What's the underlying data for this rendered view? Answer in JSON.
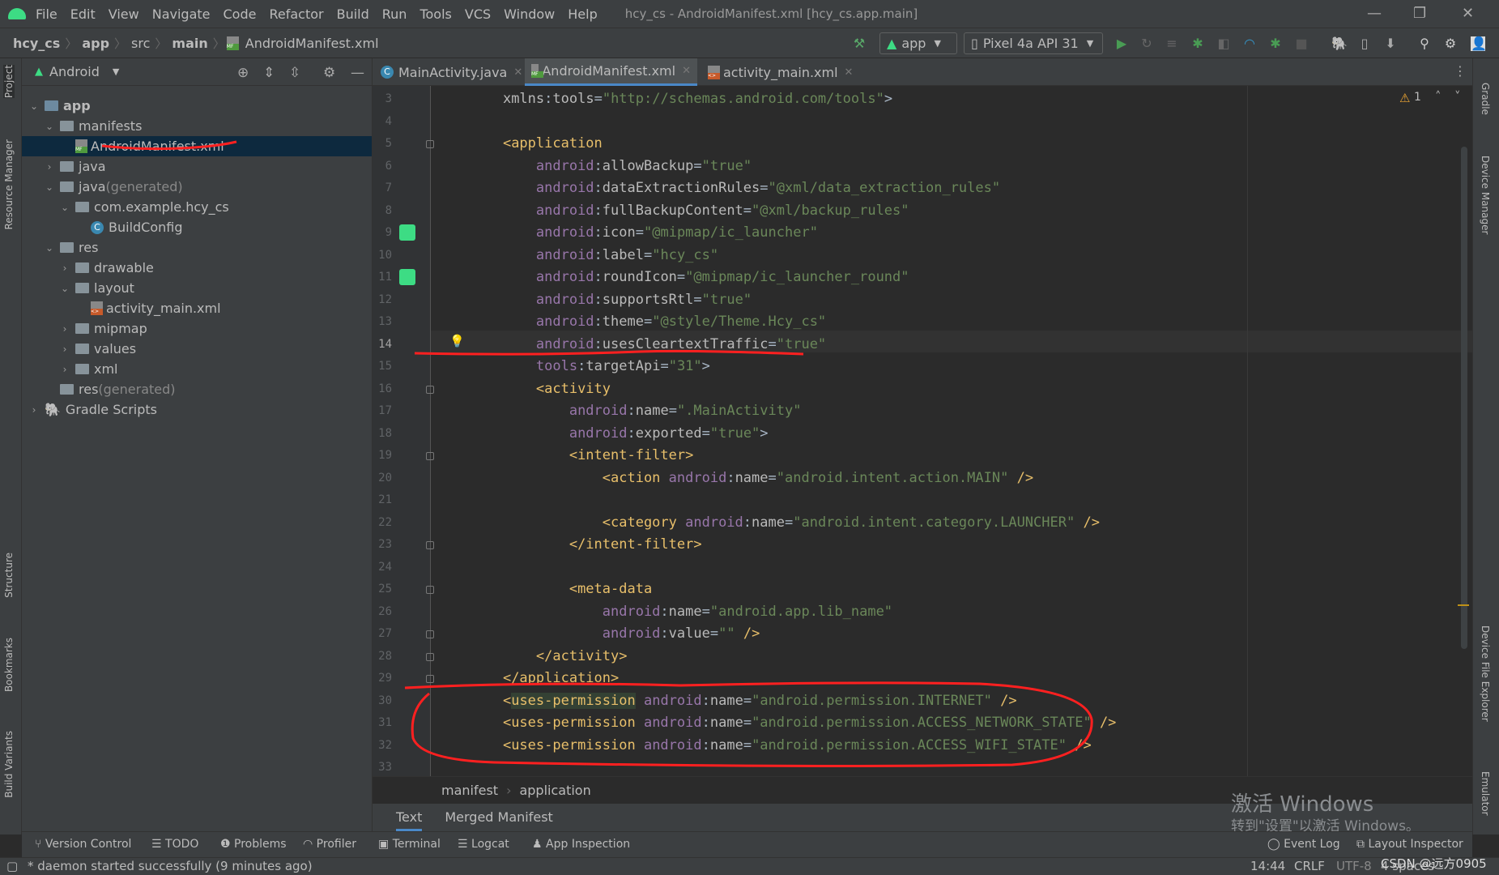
{
  "window": {
    "menu": [
      "File",
      "Edit",
      "View",
      "Navigate",
      "Code",
      "Refactor",
      "Build",
      "Run",
      "Tools",
      "VCS",
      "Window",
      "Help"
    ],
    "title": "hcy_cs - AndroidManifest.xml [hcy_cs.app.main]"
  },
  "navbar": {
    "breadcrumbs": [
      "hcy_cs",
      "app",
      "src",
      "main",
      "AndroidManifest.xml"
    ],
    "run_config": "app",
    "device": "Pixel 4a API 31"
  },
  "project_panel": {
    "view_selector": "Android",
    "tree": [
      {
        "label": "app",
        "suffix": "",
        "depth": 0,
        "expanded": true,
        "icon": "module",
        "bold": true
      },
      {
        "label": "manifests",
        "suffix": "",
        "depth": 1,
        "expanded": true,
        "icon": "folder"
      },
      {
        "label": "AndroidManifest.xml",
        "suffix": "",
        "depth": 2,
        "icon": "manifest-file",
        "selected": true
      },
      {
        "label": "java",
        "suffix": "",
        "depth": 1,
        "expanded": false,
        "icon": "folder"
      },
      {
        "label": "java",
        "suffix": " (generated)",
        "depth": 1,
        "expanded": true,
        "icon": "folder"
      },
      {
        "label": "com.example.hcy_cs",
        "suffix": "",
        "depth": 2,
        "expanded": true,
        "icon": "package"
      },
      {
        "label": "BuildConfig",
        "suffix": "",
        "depth": 3,
        "icon": "class"
      },
      {
        "label": "res",
        "suffix": "",
        "depth": 1,
        "expanded": true,
        "icon": "folder"
      },
      {
        "label": "drawable",
        "suffix": "",
        "depth": 2,
        "expanded": false,
        "icon": "folder"
      },
      {
        "label": "layout",
        "suffix": "",
        "depth": 2,
        "expanded": true,
        "icon": "folder"
      },
      {
        "label": "activity_main.xml",
        "suffix": "",
        "depth": 3,
        "icon": "layout-file"
      },
      {
        "label": "mipmap",
        "suffix": "",
        "depth": 2,
        "expanded": false,
        "icon": "folder"
      },
      {
        "label": "values",
        "suffix": "",
        "depth": 2,
        "expanded": false,
        "icon": "folder"
      },
      {
        "label": "xml",
        "suffix": "",
        "depth": 2,
        "expanded": false,
        "icon": "folder"
      },
      {
        "label": "res",
        "suffix": " (generated)",
        "depth": 1,
        "icon": "folder"
      },
      {
        "label": "Gradle Scripts",
        "suffix": "",
        "depth": 0,
        "expanded": false,
        "icon": "gradle"
      }
    ]
  },
  "tabs": [
    {
      "label": "MainActivity.java",
      "active": false
    },
    {
      "label": "AndroidManifest.xml",
      "active": true
    },
    {
      "label": "activity_main.xml",
      "active": false
    }
  ],
  "editor": {
    "warning_count": "1",
    "current_line": 14,
    "lines": [
      {
        "n": 3,
        "t": [
          [
            "p",
            "    "
          ],
          [
            "attr",
            "xmlns"
          ],
          [
            "p",
            ":"
          ],
          [
            "attr",
            "tools"
          ],
          [
            "p",
            "="
          ],
          [
            "val",
            "\"http://schemas.android.com/tools\""
          ],
          [
            "p",
            ">"
          ]
        ]
      },
      {
        "n": 4,
        "t": []
      },
      {
        "n": 5,
        "t": [
          [
            "p",
            "    "
          ],
          [
            "tag",
            "<application"
          ]
        ]
      },
      {
        "n": 6,
        "t": [
          [
            "p",
            "        "
          ],
          [
            "ns",
            "android"
          ],
          [
            "p",
            ":"
          ],
          [
            "attr",
            "allowBackup"
          ],
          [
            "p",
            "="
          ],
          [
            "val",
            "\"true\""
          ]
        ]
      },
      {
        "n": 7,
        "t": [
          [
            "p",
            "        "
          ],
          [
            "ns",
            "android"
          ],
          [
            "p",
            ":"
          ],
          [
            "attr",
            "dataExtractionRules"
          ],
          [
            "p",
            "="
          ],
          [
            "val",
            "\"@xml/data_extraction_rules\""
          ]
        ]
      },
      {
        "n": 8,
        "t": [
          [
            "p",
            "        "
          ],
          [
            "ns",
            "android"
          ],
          [
            "p",
            ":"
          ],
          [
            "attr",
            "fullBackupContent"
          ],
          [
            "p",
            "="
          ],
          [
            "val",
            "\"@xml/backup_rules\""
          ]
        ]
      },
      {
        "n": 9,
        "t": [
          [
            "p",
            "        "
          ],
          [
            "ns",
            "android"
          ],
          [
            "p",
            ":"
          ],
          [
            "attr",
            "icon"
          ],
          [
            "p",
            "="
          ],
          [
            "val",
            "\"@mipmap/ic_launcher\""
          ]
        ]
      },
      {
        "n": 10,
        "t": [
          [
            "p",
            "        "
          ],
          [
            "ns",
            "android"
          ],
          [
            "p",
            ":"
          ],
          [
            "attr",
            "label"
          ],
          [
            "p",
            "="
          ],
          [
            "val",
            "\"hcy_cs\""
          ]
        ]
      },
      {
        "n": 11,
        "t": [
          [
            "p",
            "        "
          ],
          [
            "ns",
            "android"
          ],
          [
            "p",
            ":"
          ],
          [
            "attr",
            "roundIcon"
          ],
          [
            "p",
            "="
          ],
          [
            "val",
            "\"@mipmap/ic_launcher_round\""
          ]
        ]
      },
      {
        "n": 12,
        "t": [
          [
            "p",
            "        "
          ],
          [
            "ns",
            "android"
          ],
          [
            "p",
            ":"
          ],
          [
            "attr",
            "supportsRtl"
          ],
          [
            "p",
            "="
          ],
          [
            "val",
            "\"true\""
          ]
        ]
      },
      {
        "n": 13,
        "t": [
          [
            "p",
            "        "
          ],
          [
            "ns",
            "android"
          ],
          [
            "p",
            ":"
          ],
          [
            "attr",
            "theme"
          ],
          [
            "p",
            "="
          ],
          [
            "val",
            "\"@style/Theme.Hcy_cs\""
          ]
        ]
      },
      {
        "n": 14,
        "t": [
          [
            "p",
            "        "
          ],
          [
            "ns",
            "android"
          ],
          [
            "p",
            ":"
          ],
          [
            "attr",
            "usesCleartextTraffic"
          ],
          [
            "p",
            "="
          ],
          [
            "val",
            "\"true\""
          ]
        ]
      },
      {
        "n": 15,
        "t": [
          [
            "p",
            "        "
          ],
          [
            "ns",
            "tools"
          ],
          [
            "p",
            ":"
          ],
          [
            "attr",
            "targetApi"
          ],
          [
            "p",
            "="
          ],
          [
            "val",
            "\"31\""
          ],
          [
            "p",
            ">"
          ]
        ]
      },
      {
        "n": 16,
        "t": [
          [
            "p",
            "        "
          ],
          [
            "tag",
            "<activity"
          ]
        ]
      },
      {
        "n": 17,
        "t": [
          [
            "p",
            "            "
          ],
          [
            "ns",
            "android"
          ],
          [
            "p",
            ":"
          ],
          [
            "attr",
            "name"
          ],
          [
            "p",
            "="
          ],
          [
            "val",
            "\".MainActivity\""
          ]
        ]
      },
      {
        "n": 18,
        "t": [
          [
            "p",
            "            "
          ],
          [
            "ns",
            "android"
          ],
          [
            "p",
            ":"
          ],
          [
            "attr",
            "exported"
          ],
          [
            "p",
            "="
          ],
          [
            "val",
            "\"true\""
          ],
          [
            "p",
            ">"
          ]
        ]
      },
      {
        "n": 19,
        "t": [
          [
            "p",
            "            "
          ],
          [
            "tag",
            "<intent-filter>"
          ]
        ]
      },
      {
        "n": 20,
        "t": [
          [
            "p",
            "                "
          ],
          [
            "tag",
            "<action "
          ],
          [
            "ns",
            "android"
          ],
          [
            "p",
            ":"
          ],
          [
            "attr",
            "name"
          ],
          [
            "p",
            "="
          ],
          [
            "val",
            "\"android.intent.action.MAIN\""
          ],
          [
            "tag",
            " />"
          ]
        ]
      },
      {
        "n": 21,
        "t": []
      },
      {
        "n": 22,
        "t": [
          [
            "p",
            "                "
          ],
          [
            "tag",
            "<category "
          ],
          [
            "ns",
            "android"
          ],
          [
            "p",
            ":"
          ],
          [
            "attr",
            "name"
          ],
          [
            "p",
            "="
          ],
          [
            "val",
            "\"android.intent.category.LAUNCHER\""
          ],
          [
            "tag",
            " />"
          ]
        ]
      },
      {
        "n": 23,
        "t": [
          [
            "p",
            "            "
          ],
          [
            "tag",
            "</intent-filter>"
          ]
        ]
      },
      {
        "n": 24,
        "t": []
      },
      {
        "n": 25,
        "t": [
          [
            "p",
            "            "
          ],
          [
            "tag",
            "<meta-data"
          ]
        ]
      },
      {
        "n": 26,
        "t": [
          [
            "p",
            "                "
          ],
          [
            "ns",
            "android"
          ],
          [
            "p",
            ":"
          ],
          [
            "attr",
            "name"
          ],
          [
            "p",
            "="
          ],
          [
            "val",
            "\"android.app.lib_name\""
          ]
        ]
      },
      {
        "n": 27,
        "t": [
          [
            "p",
            "                "
          ],
          [
            "ns",
            "android"
          ],
          [
            "p",
            ":"
          ],
          [
            "attr",
            "value"
          ],
          [
            "p",
            "="
          ],
          [
            "val",
            "\"\""
          ],
          [
            "tag",
            " />"
          ]
        ]
      },
      {
        "n": 28,
        "t": [
          [
            "p",
            "        "
          ],
          [
            "tag",
            "</activity>"
          ]
        ]
      },
      {
        "n": 29,
        "t": [
          [
            "p",
            "    "
          ],
          [
            "tag",
            "</application>"
          ]
        ]
      },
      {
        "n": 30,
        "t": [
          [
            "p",
            "    "
          ],
          [
            "tag",
            "<"
          ],
          [
            "hl",
            "uses-permission"
          ],
          [
            "tag",
            " "
          ],
          [
            "ns",
            "android"
          ],
          [
            "p",
            ":"
          ],
          [
            "attr",
            "name"
          ],
          [
            "p",
            "="
          ],
          [
            "val",
            "\"android.permission.INTERNET\""
          ],
          [
            "tag",
            " />"
          ]
        ]
      },
      {
        "n": 31,
        "t": [
          [
            "p",
            "    "
          ],
          [
            "tag",
            "<uses-permission "
          ],
          [
            "ns",
            "android"
          ],
          [
            "p",
            ":"
          ],
          [
            "attr",
            "name"
          ],
          [
            "p",
            "="
          ],
          [
            "val",
            "\"android.permission.ACCESS_NETWORK_STATE\""
          ],
          [
            "tag",
            " />"
          ]
        ]
      },
      {
        "n": 32,
        "t": [
          [
            "p",
            "    "
          ],
          [
            "tag",
            "<uses-permission "
          ],
          [
            "ns",
            "android"
          ],
          [
            "p",
            ":"
          ],
          [
            "attr",
            "name"
          ],
          [
            "p",
            "="
          ],
          [
            "val",
            "\"android.permission.ACCESS_WIFI_STATE\""
          ],
          [
            "tag",
            " />"
          ]
        ]
      },
      {
        "n": 33,
        "t": []
      }
    ],
    "breadcrumb": [
      "manifest",
      "application"
    ],
    "bottom_tabs": [
      "Text",
      "Merged Manifest"
    ]
  },
  "left_stripe": [
    "Project",
    "Resource Manager",
    "Structure",
    "Bookmarks",
    "Build Variants"
  ],
  "right_stripe": [
    "Gradle",
    "Device Manager",
    "Device File Explorer",
    "Emulator"
  ],
  "tool_windows": [
    "Version Control",
    "TODO",
    "Problems",
    "Profiler",
    "Terminal",
    "Logcat",
    "App Inspection"
  ],
  "tool_windows_right": [
    "Event Log",
    "Layout Inspector"
  ],
  "status": {
    "message": "* daemon started successfully (9 minutes ago)",
    "position": "14:44",
    "line_sep": "CRLF",
    "encoding": "UTF-8",
    "indent": "4 spaces"
  },
  "watermark": {
    "line1": "激活 Windows",
    "line2": "转到\"设置\"以激活 Windows。",
    "csdn": "CSDN @远方0905"
  },
  "colors": {
    "annotation": "#ff2020",
    "accent": "#4a88c7",
    "android_green": "#3ddc84"
  }
}
